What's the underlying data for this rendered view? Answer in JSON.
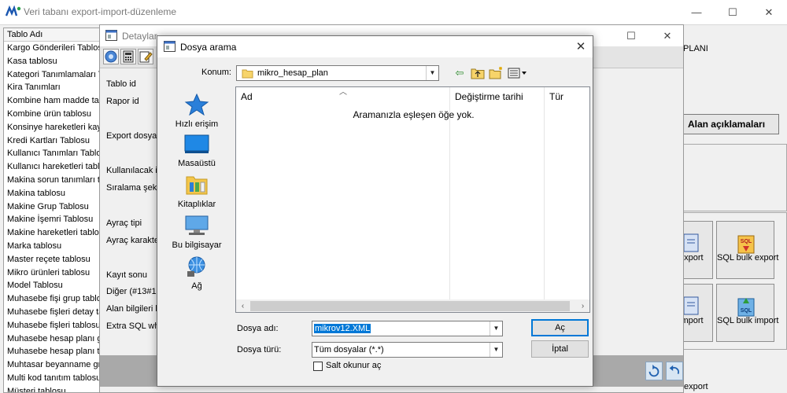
{
  "main_window": {
    "title": "Veri tabanı export-import-düzenleme",
    "controls": {
      "minimize": "—",
      "maximize": "☐",
      "close": "✕"
    }
  },
  "table_list": {
    "header": "Tablo Adı",
    "rows": [
      "Kargo Gönderileri Tablosu",
      "Kasa tablosu",
      "Kategori Tanımlamaları Tablosu",
      "Kira Tanımları",
      "Kombine ham madde tablosu",
      "Kombine ürün tablosu",
      "Konsinye hareketleri kayıtları",
      "Kredi Kartları Tablosu",
      "Kullanıcı Tanımları Tablosu",
      "Kullanıcı hareketleri tablosu",
      "Makina sorun tanımları tablosu",
      "Makina tablosu",
      "Makine Grup Tablosu",
      "Makine İşemri Tablosu",
      "Makine hareketleri tablosu",
      "Marka tablosu",
      "Master reçete tablosu",
      "Mikro ürünleri tablosu",
      "Model Tablosu",
      "Muhasebe fişi grup tablosu",
      "Muhasebe fişleri detay tablosu",
      "Muhasebe fişleri tablosu",
      "Muhasebe hesap planı grupları",
      "Muhasebe hesap planı tablosu",
      "Muhtasar beyanname grupları",
      "Multi kod tanıtım tablosu",
      "Müşteri tablosu"
    ]
  },
  "details_window": {
    "title": "Detaylar",
    "controls": {
      "maximize": "☐",
      "close": "✕"
    },
    "labels": [
      "Tablo id",
      "Rapor id",
      "Export dosyası",
      "Kullanılacak indeks",
      "Sıralama şekli",
      "Ayraç tipi",
      "Ayraç karakteri",
      "Kayıt sonu",
      "Diğer (#13#10)",
      "Alan bilgileri kodu",
      "Extra SQL where"
    ]
  },
  "right_side": {
    "plan_label": "PLANI",
    "field_descriptions_button": "Alan açıklamaları",
    "help_button": "?",
    "buttons": {
      "xml_export": "export",
      "sql_bulk_export": "SQL bulk export",
      "xml_import": "import",
      "sql_bulk_import": "SQL bulk import",
      "bottom_export": "export"
    },
    "sql_icon_text": "SQL"
  },
  "dialog": {
    "title": "Dosya arama",
    "close": "✕",
    "location_label": "Konum:",
    "location_value": "mikro_hesap_plan",
    "places": [
      {
        "label": "Hızlı erişim",
        "icon": "star-icon"
      },
      {
        "label": "Masaüstü",
        "icon": "desktop-icon"
      },
      {
        "label": "Kitaplıklar",
        "icon": "libraries-icon"
      },
      {
        "label": "Bu bilgisayar",
        "icon": "computer-icon"
      },
      {
        "label": "Ağ",
        "icon": "network-icon"
      }
    ],
    "columns": {
      "name": "Ad",
      "date": "Değiştirme tarihi",
      "type": "Tür"
    },
    "empty_message": "Aramanızla eşleşen öğe yok.",
    "filename_label": "Dosya adı:",
    "filename_value": "mikrov12.XML",
    "filetype_label": "Dosya türü:",
    "filetype_value": "Tüm dosyalar (*.*)",
    "open_button": "Aç",
    "cancel_button": "İptal",
    "readonly_label": "Salt okunur aç",
    "readonly_checked": false
  }
}
